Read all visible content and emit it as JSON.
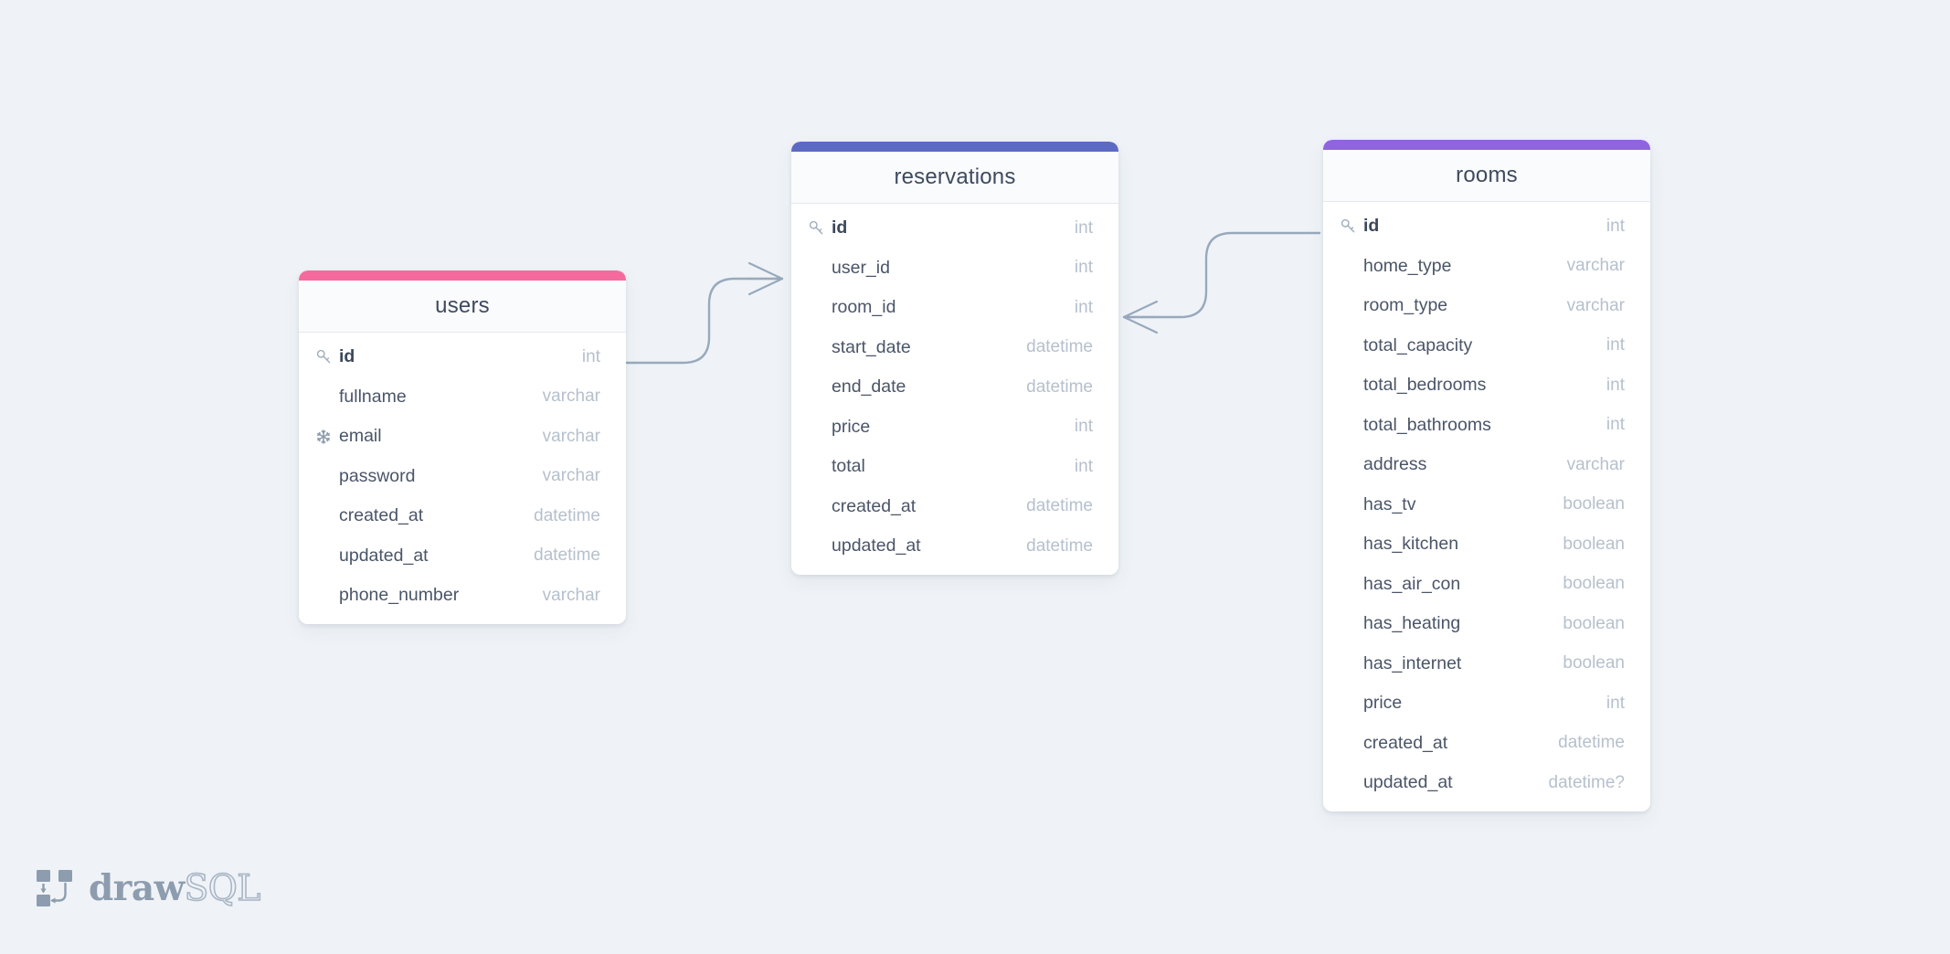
{
  "app": {
    "name": "drawSQL",
    "logo_text_bold": "draw",
    "logo_text_outline": "SQL",
    "background_color": "#eff3f7"
  },
  "diagram": {
    "type": "entity-relationship-diagram",
    "tables": [
      {
        "name": "users",
        "accent_color": "#f56a9c",
        "columns": [
          {
            "name": "id",
            "type": "int",
            "icon": "key-icon"
          },
          {
            "name": "fullname",
            "type": "varchar",
            "icon": ""
          },
          {
            "name": "email",
            "type": "varchar",
            "icon": "snowflake-icon"
          },
          {
            "name": "password",
            "type": "varchar",
            "icon": ""
          },
          {
            "name": "created_at",
            "type": "datetime",
            "icon": ""
          },
          {
            "name": "updated_at",
            "type": "datetime",
            "icon": ""
          },
          {
            "name": "phone_number",
            "type": "varchar",
            "icon": ""
          }
        ]
      },
      {
        "name": "reservations",
        "accent_color": "#5c6ac4",
        "columns": [
          {
            "name": "id",
            "type": "int",
            "icon": "key-icon"
          },
          {
            "name": "user_id",
            "type": "int",
            "icon": ""
          },
          {
            "name": "room_id",
            "type": "int",
            "icon": ""
          },
          {
            "name": "start_date",
            "type": "datetime",
            "icon": ""
          },
          {
            "name": "end_date",
            "type": "datetime",
            "icon": ""
          },
          {
            "name": "price",
            "type": "int",
            "icon": ""
          },
          {
            "name": "total",
            "type": "int",
            "icon": ""
          },
          {
            "name": "created_at",
            "type": "datetime",
            "icon": ""
          },
          {
            "name": "updated_at",
            "type": "datetime",
            "icon": ""
          }
        ]
      },
      {
        "name": "rooms",
        "accent_color": "#9063e0",
        "columns": [
          {
            "name": "id",
            "type": "int",
            "icon": "key-icon"
          },
          {
            "name": "home_type",
            "type": "varchar",
            "icon": ""
          },
          {
            "name": "room_type",
            "type": "varchar",
            "icon": ""
          },
          {
            "name": "total_capacity",
            "type": "int",
            "icon": ""
          },
          {
            "name": "total_bedrooms",
            "type": "int",
            "icon": ""
          },
          {
            "name": "total_bathrooms",
            "type": "int",
            "icon": ""
          },
          {
            "name": "address",
            "type": "varchar",
            "icon": ""
          },
          {
            "name": "has_tv",
            "type": "boolean",
            "icon": ""
          },
          {
            "name": "has_kitchen",
            "type": "boolean",
            "icon": ""
          },
          {
            "name": "has_air_con",
            "type": "boolean",
            "icon": ""
          },
          {
            "name": "has_heating",
            "type": "boolean",
            "icon": ""
          },
          {
            "name": "has_internet",
            "type": "boolean",
            "icon": ""
          },
          {
            "name": "price",
            "type": "int",
            "icon": ""
          },
          {
            "name": "created_at",
            "type": "datetime",
            "icon": ""
          },
          {
            "name": "updated_at",
            "type": "datetime?",
            "icon": ""
          }
        ]
      }
    ],
    "relationships": [
      {
        "from_table": "users",
        "from_column": "id",
        "to_table": "reservations",
        "to_column": "user_id",
        "cardinality": "one-to-many"
      },
      {
        "from_table": "reservations",
        "from_column": "room_id",
        "to_table": "rooms",
        "to_column": "id",
        "cardinality": "many-to-one"
      }
    ],
    "line_color": "#98a9bd"
  }
}
